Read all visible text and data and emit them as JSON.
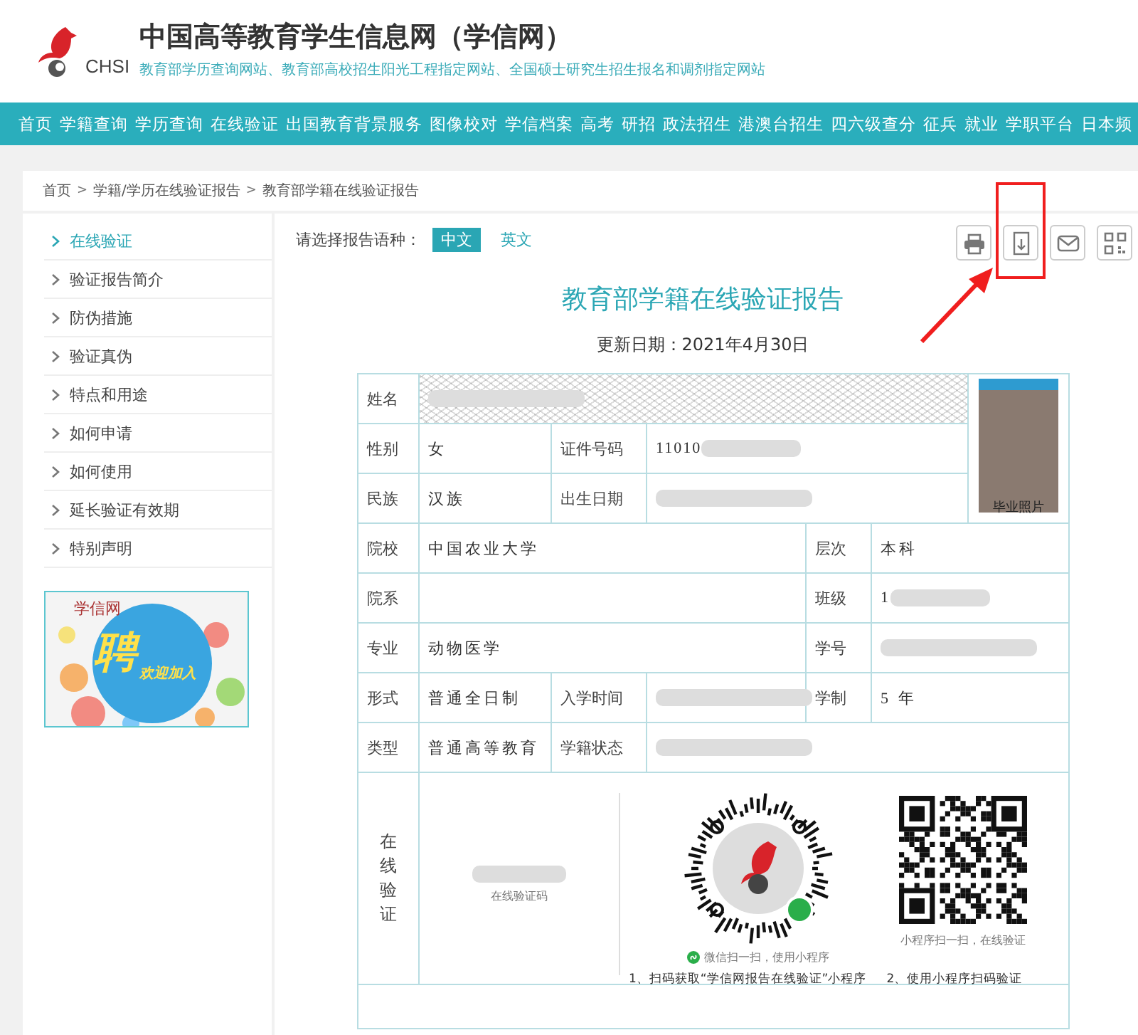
{
  "header": {
    "logo_text": "CHSI",
    "title": "中国高等教育学生信息网（学信网）",
    "subtitle": "教育部学历查询网站、教育部高校招生阳光工程指定网站、全国硕士研究生招生报名和调剂指定网站"
  },
  "nav": {
    "items": [
      "首页",
      "学籍查询",
      "学历查询",
      "在线验证",
      "出国教育背景服务",
      "图像校对",
      "学信档案",
      "高考",
      "研招",
      "政法招生",
      "港澳台招生",
      "四六级查分",
      "征兵",
      "就业",
      "学职平台",
      "日本频"
    ]
  },
  "breadcrumb": {
    "links": [
      "首页",
      "学籍/学历在线验证报告",
      "教育部学籍在线验证报告"
    ],
    "separators": [
      ">",
      ">"
    ]
  },
  "sidebar": {
    "items": [
      {
        "label": "在线验证",
        "selected": true
      },
      {
        "label": "验证报告简介",
        "selected": false
      },
      {
        "label": "防伪措施",
        "selected": false
      },
      {
        "label": "验证真伪",
        "selected": false
      },
      {
        "label": "特点和用途",
        "selected": false
      },
      {
        "label": "如何申请",
        "selected": false
      },
      {
        "label": "如何使用",
        "selected": false
      },
      {
        "label": "延长验证有效期",
        "selected": false
      },
      {
        "label": "特别声明",
        "selected": false
      }
    ],
    "banner": {
      "brand": "学信网",
      "headline": "聘",
      "tagline": "欢迎加入"
    }
  },
  "language": {
    "label": "请选择报告语种：",
    "options": [
      {
        "label": "中文",
        "selected": true
      },
      {
        "label": "英文",
        "selected": false
      }
    ]
  },
  "tools": [
    {
      "kind": "print",
      "highlighted": false
    },
    {
      "kind": "pdf",
      "highlighted": true
    },
    {
      "kind": "mail",
      "highlighted": false
    },
    {
      "kind": "qr",
      "highlighted": false
    }
  ],
  "report": {
    "title": "教育部学籍在线验证报告",
    "updated": "更新日期：2021年4月30日",
    "rows": [
      {
        "cells": [
          {
            "kind": "label",
            "text": "姓名"
          },
          {
            "kind": "redacted",
            "colspan": 5
          },
          {
            "kind": "photo",
            "text": "毕业照片",
            "rowspan": 3
          }
        ]
      },
      {
        "cells": [
          {
            "kind": "label",
            "text": "性别"
          },
          {
            "kind": "value",
            "text": "女"
          },
          {
            "kind": "label",
            "text": "证件号码"
          },
          {
            "kind": "partial",
            "text": "11010",
            "colspan": 3
          }
        ]
      },
      {
        "cells": [
          {
            "kind": "label",
            "text": "民族"
          },
          {
            "kind": "value",
            "text": "汉族"
          },
          {
            "kind": "label",
            "text": "出生日期"
          },
          {
            "kind": "redacted",
            "colspan": 3
          }
        ]
      },
      {
        "cells": [
          {
            "kind": "label",
            "text": "院校"
          },
          {
            "kind": "value",
            "text": "中国农业大学",
            "colspan": 3
          },
          {
            "kind": "label",
            "text": "层次"
          },
          {
            "kind": "value",
            "text": "本科",
            "colspan": 2
          }
        ]
      },
      {
        "cells": [
          {
            "kind": "label",
            "text": "院系"
          },
          {
            "kind": "empty",
            "colspan": 3
          },
          {
            "kind": "label",
            "text": "班级"
          },
          {
            "kind": "partial",
            "text": "1",
            "colspan": 2
          }
        ]
      },
      {
        "cells": [
          {
            "kind": "label",
            "text": "专业"
          },
          {
            "kind": "value",
            "text": "动物医学",
            "colspan": 3
          },
          {
            "kind": "label",
            "text": "学号"
          },
          {
            "kind": "redacted",
            "colspan": 2
          }
        ]
      },
      {
        "cells": [
          {
            "kind": "label",
            "text": "形式"
          },
          {
            "kind": "value",
            "text": "普通全日制"
          },
          {
            "kind": "label",
            "text": "入学时间"
          },
          {
            "kind": "redacted"
          },
          {
            "kind": "label",
            "text": "学制"
          },
          {
            "kind": "value",
            "text": "5 年",
            "colspan": 2
          }
        ]
      },
      {
        "cells": [
          {
            "kind": "label",
            "text": "类型"
          },
          {
            "kind": "value",
            "text": "普通高等教育"
          },
          {
            "kind": "label",
            "text": "学籍状态"
          },
          {
            "kind": "redacted",
            "colspan": 4
          }
        ]
      }
    ],
    "verify": {
      "label": "在线验证",
      "code_caption": "在线验证码",
      "miniapp_caption": "微信扫一扫，使用小程序",
      "qr_caption": "小程序扫一扫，在线验证",
      "steps": [
        "1、扫码获取“学信网报告在线验证”小程序",
        "2、使用小程序扫码验证"
      ]
    }
  }
}
